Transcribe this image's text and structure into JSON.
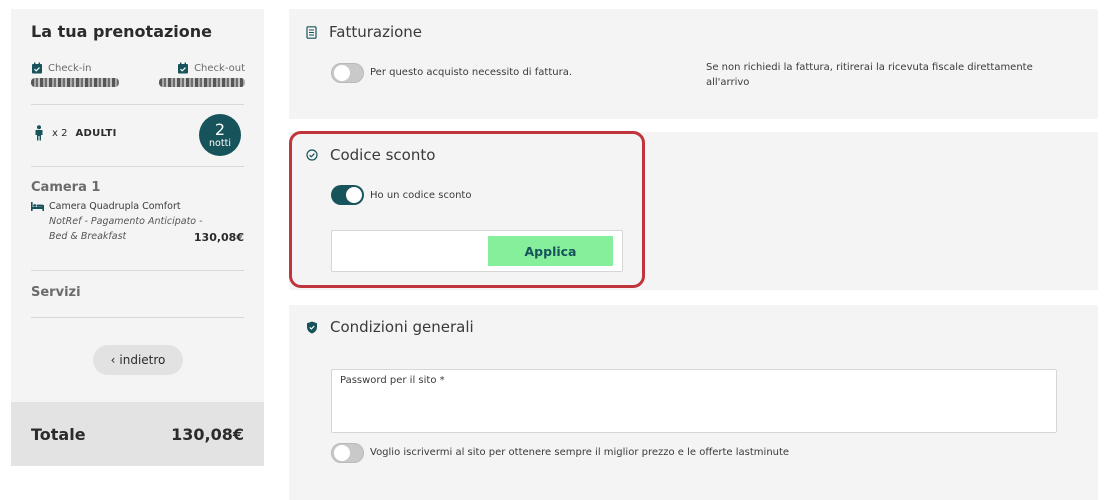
{
  "sidebar": {
    "title": "La tua prenotazione",
    "checkin_label": "Check-in",
    "checkout_label": "Check-out",
    "guests_count": "x 2",
    "guests_type": "ADULTI",
    "nights_number": "2",
    "nights_label": "notti",
    "room_title": "Camera 1",
    "room_name": "Camera Quadrupla Comfort",
    "room_rate": "NotRef - Pagamento Anticipato - Bed & Breakfast",
    "room_price": "130,08€",
    "services_label": "Servizi",
    "back_label": "indietro",
    "total_label": "Totale",
    "total_value": "130,08€"
  },
  "billing": {
    "title": "Fatturazione",
    "toggle_label": "Per questo acquisto necessito di fattura.",
    "toggle_on": false,
    "note": "Se non richiedi la fattura, ritirerai la ricevuta fiscale direttamente all'arrivo"
  },
  "discount": {
    "title": "Codice sconto",
    "toggle_label": "Ho un codice sconto",
    "toggle_on": true,
    "input_value": "",
    "apply_label": "Applica"
  },
  "conditions": {
    "title": "Condizioni generali",
    "password_label": "Password per il sito *",
    "password_value": "",
    "newsletter_label": "Voglio iscrivermi al sito per ottenere sempre il miglior prezzo e le offerte lastminute",
    "newsletter_on": false
  },
  "colors": {
    "accent": "#17535a",
    "apply_button": "#86ef9b",
    "highlight_border": "#c0353b",
    "panel_bg": "#f4f4f4"
  }
}
